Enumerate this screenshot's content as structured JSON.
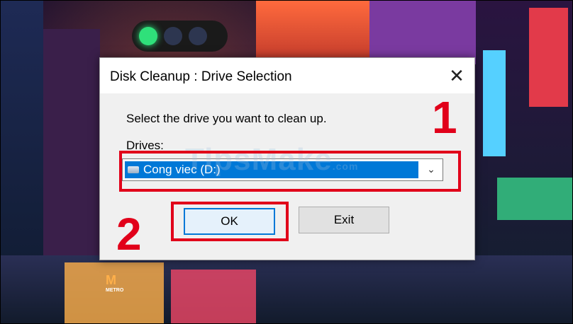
{
  "dialog": {
    "title": "Disk Cleanup : Drive Selection",
    "close_glyph": "✕",
    "prompt": "Select the drive you want to clean up.",
    "drives_label": "Drives:",
    "selected_drive": "Cong viec (D:)",
    "chevron_glyph": "⌄",
    "ok_label": "OK",
    "exit_label": "Exit"
  },
  "annotations": {
    "step1": "1",
    "step2": "2"
  },
  "watermark": {
    "text": "TipsMake",
    "suffix": ".com"
  },
  "background": {
    "sign_text": "M",
    "sign_sub": "METRO"
  },
  "colors": {
    "accent": "#0078d7",
    "annotation": "#e1001a"
  }
}
